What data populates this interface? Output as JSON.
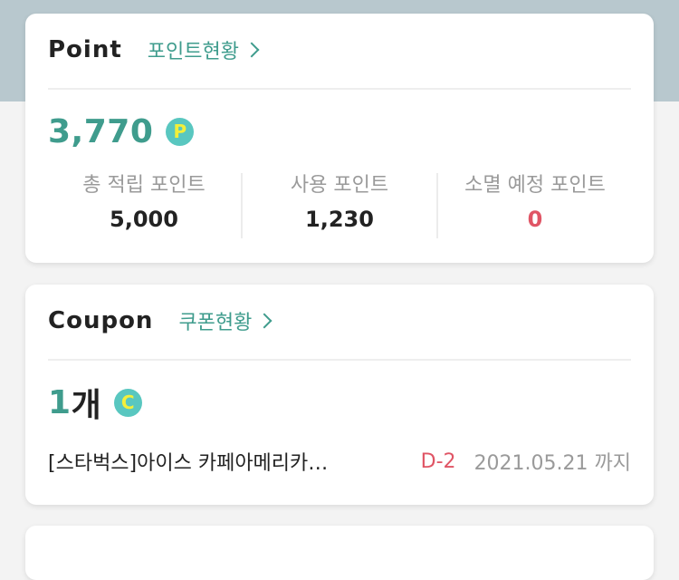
{
  "point": {
    "title": "Point",
    "status_link": "포인트현황",
    "amount": "3,770",
    "badge": "P",
    "stats": [
      {
        "label": "총 적립 포인트",
        "value": "5,000"
      },
      {
        "label": "사용 포인트",
        "value": "1,230"
      },
      {
        "label": "소멸 예정 포인트",
        "value": "0"
      }
    ]
  },
  "coupon": {
    "title": "Coupon",
    "status_link": "쿠폰현황",
    "count": "1",
    "count_unit": "개",
    "badge": "C",
    "item": {
      "name": "[스타벅스]아이스 카페아메리카…",
      "dday": "D-2",
      "expiry": "2021.05.21 까지"
    }
  },
  "colors": {
    "accent": "#3f9c8d",
    "badge_bg": "#59c7c0",
    "badge_fg": "#f3ef3a",
    "alert": "#e05565",
    "header_band": "#b8c8ce"
  },
  "icons": {
    "chevron": "chevron-right-icon",
    "point_badge": "point-badge-icon",
    "coupon_badge": "coupon-badge-icon"
  }
}
